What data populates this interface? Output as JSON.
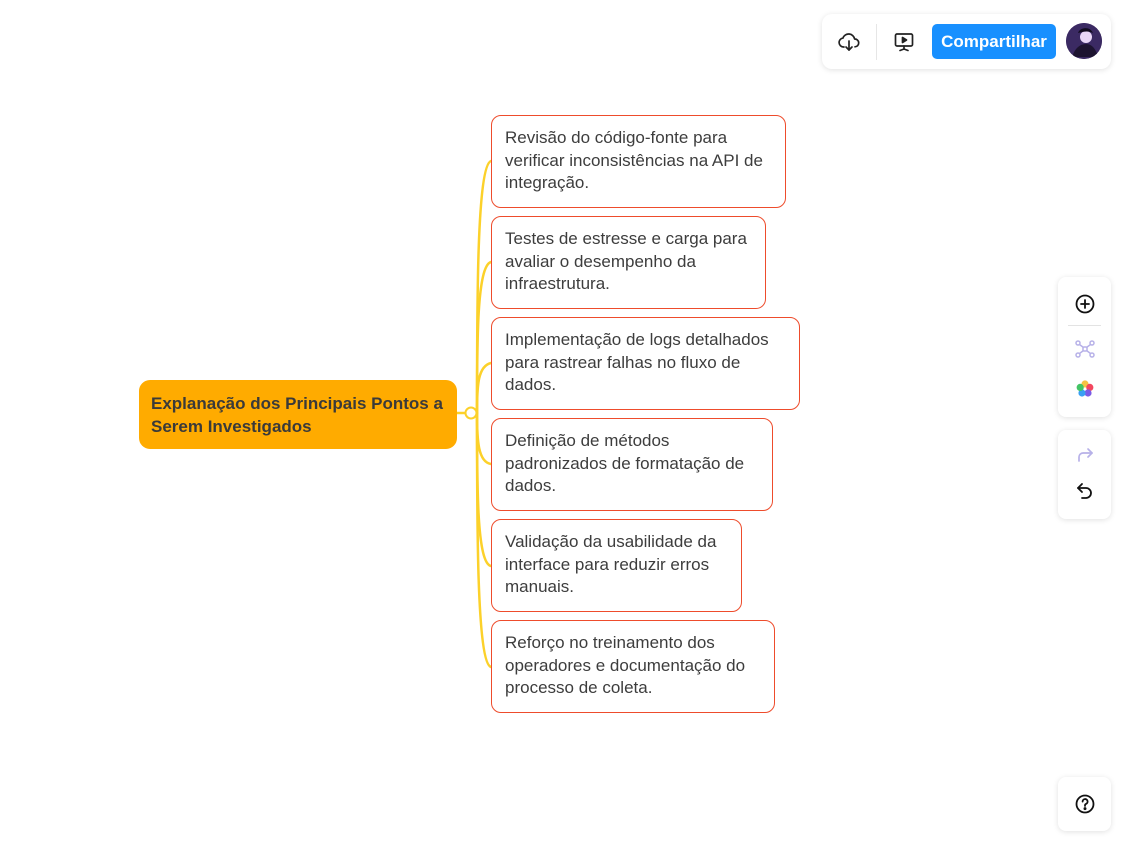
{
  "toolbar": {
    "download_icon": "cloud-download-icon",
    "present_icon": "presentation-play-icon",
    "share_label": "Compartilhar"
  },
  "side_toolbar": {
    "icons": [
      "add-circle-icon",
      "layout-structure-icon",
      "color-palette-icon",
      "redo-icon",
      "undo-icon"
    ]
  },
  "help": {
    "icon": "help-circle-icon"
  },
  "mindmap": {
    "root": "Explanação dos Principais Pontos a Serem Investigados",
    "children": [
      "Revisão do código-fonte para verificar inconsistências na API de integração.",
      "Testes de estresse e carga para avaliar o desempenho da infraestrutura.",
      "Implementação de logs detalhados para rastrear falhas no fluxo de dados.",
      "Definição de métodos padronizados de formatação de dados.",
      "Validação da usabilidade da interface para reduzir erros manuais.",
      "Reforço no treinamento dos operadores e documentação do processo de coleta."
    ]
  },
  "colors": {
    "root_fill": "#ffab00",
    "branch_line": "#fcd12a",
    "child_border": "#ee4c2c",
    "share_button": "#1890ff"
  }
}
